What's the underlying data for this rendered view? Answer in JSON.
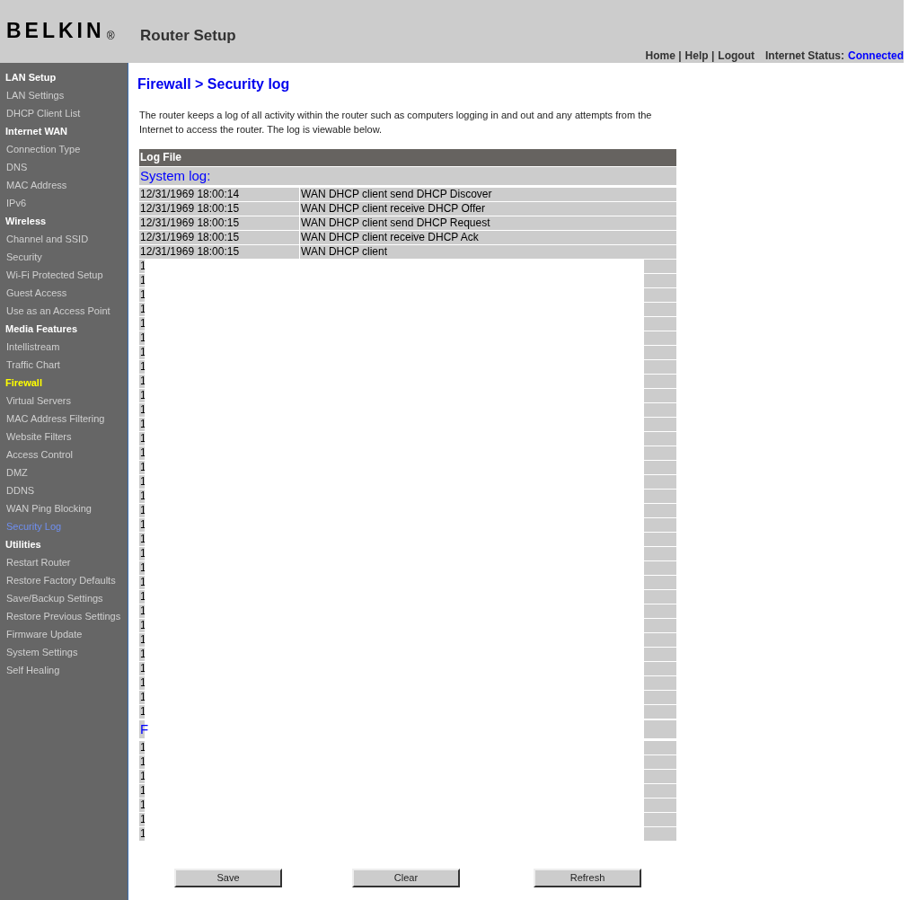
{
  "header": {
    "logo": "BELKIN",
    "logo_mark": "®",
    "title": "Router Setup",
    "links": [
      "Home |",
      "Help |",
      "Logout"
    ],
    "status_label": "Internet Status:",
    "status_value": "Connected"
  },
  "sidebar": [
    {
      "heading": "LAN Setup",
      "selected": false,
      "items": [
        {
          "label": "LAN Settings",
          "selected": false
        },
        {
          "label": "DHCP Client List",
          "selected": false
        }
      ]
    },
    {
      "heading": "Internet WAN",
      "selected": false,
      "items": [
        {
          "label": "Connection Type",
          "selected": false
        },
        {
          "label": "DNS",
          "selected": false
        },
        {
          "label": "MAC Address",
          "selected": false
        },
        {
          "label": "IPv6",
          "selected": false
        }
      ]
    },
    {
      "heading": "Wireless",
      "selected": false,
      "items": [
        {
          "label": "Channel and SSID",
          "selected": false
        },
        {
          "label": "Security",
          "selected": false
        },
        {
          "label": "Wi-Fi Protected Setup",
          "selected": false
        },
        {
          "label": "Guest Access",
          "selected": false
        },
        {
          "label": "Use as an Access Point",
          "selected": false
        }
      ]
    },
    {
      "heading": "Media Features",
      "selected": false,
      "items": [
        {
          "label": "Intellistream",
          "selected": false
        },
        {
          "label": "Traffic Chart",
          "selected": false
        }
      ]
    },
    {
      "heading": "Firewall",
      "selected": true,
      "items": [
        {
          "label": "Virtual Servers",
          "selected": false
        },
        {
          "label": "MAC Address Filtering",
          "selected": false
        },
        {
          "label": "Website Filters",
          "selected": false
        },
        {
          "label": "Access Control",
          "selected": false
        },
        {
          "label": "DMZ",
          "selected": false
        },
        {
          "label": "DDNS",
          "selected": false
        },
        {
          "label": "WAN Ping Blocking",
          "selected": false
        },
        {
          "label": "Security Log",
          "selected": true
        }
      ]
    },
    {
      "heading": "Utilities",
      "selected": false,
      "items": [
        {
          "label": "Restart Router",
          "selected": false
        },
        {
          "label": "Restore Factory Defaults",
          "selected": false
        },
        {
          "label": "Save/Backup Settings",
          "selected": false
        },
        {
          "label": "Restore Previous Settings",
          "selected": false
        },
        {
          "label": "Firmware Update",
          "selected": false
        },
        {
          "label": "System Settings",
          "selected": false
        },
        {
          "label": "Self Healing",
          "selected": false
        }
      ]
    }
  ],
  "page_title": "Firewall > Security log",
  "intro": "The router keeps a log of all activity within the router such as computers logging in and out and any attempts from the Internet to access the router. The log is viewable below.",
  "log": {
    "header": "Log File",
    "sections": [
      {
        "title": "System log:",
        "rows": [
          {
            "time": "12/31/1969 18:00:14",
            "message": "WAN DHCP client send DHCP Discover"
          },
          {
            "time": "12/31/1969 18:00:15",
            "message": "WAN DHCP client receive DHCP Offer"
          },
          {
            "time": "12/31/1969 18:00:15",
            "message": "WAN DHCP client send DHCP Request"
          },
          {
            "time": "12/31/1969 18:00:15",
            "message": "WAN DHCP client receive DHCP Ack"
          },
          {
            "time": "12/31/1969 18:00:15",
            "message": "WAN DHCP client"
          },
          {
            "time": "1"
          },
          {
            "time": "1"
          },
          {
            "time": "1"
          },
          {
            "time": "1"
          },
          {
            "time": "1"
          },
          {
            "time": "1"
          },
          {
            "time": "1"
          },
          {
            "time": "1"
          },
          {
            "time": "1"
          },
          {
            "time": "1"
          },
          {
            "time": "1"
          },
          {
            "time": "1"
          },
          {
            "time": "1"
          },
          {
            "time": "1"
          },
          {
            "time": "1"
          },
          {
            "time": "1"
          },
          {
            "time": "1"
          },
          {
            "time": "1"
          },
          {
            "time": "1"
          },
          {
            "time": "1"
          },
          {
            "time": "1"
          },
          {
            "time": "1"
          },
          {
            "time": "1"
          },
          {
            "time": "1"
          },
          {
            "time": "1"
          },
          {
            "time": "1"
          },
          {
            "time": "1"
          },
          {
            "time": "1"
          },
          {
            "time": "1"
          },
          {
            "time": "1"
          },
          {
            "time": "1"
          },
          {
            "time": "1"
          }
        ]
      },
      {
        "title": "F",
        "rows": [
          {
            "time": "1"
          },
          {
            "time": "1"
          },
          {
            "time": "1"
          },
          {
            "time": "1"
          },
          {
            "time": "1"
          },
          {
            "time": "1"
          },
          {
            "time": "1"
          }
        ]
      }
    ]
  },
  "buttons": [
    "Save",
    "Clear",
    "Refresh"
  ]
}
